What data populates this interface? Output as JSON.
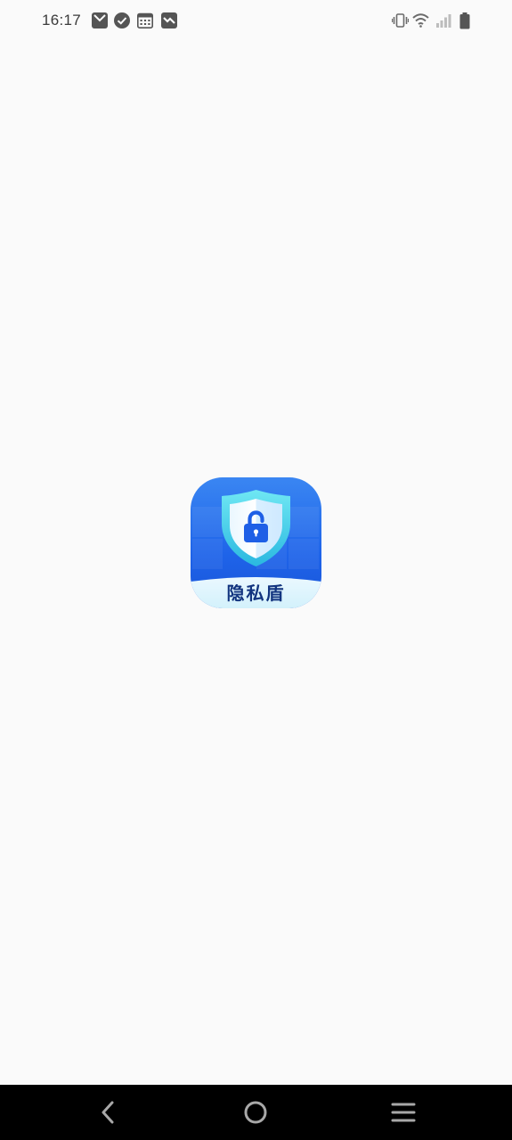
{
  "status_bar": {
    "time": "16:17",
    "notifications": [
      "mail-icon",
      "check-circle-icon",
      "calendar-icon",
      "photo-icon"
    ],
    "system": [
      "vibrate-icon",
      "wifi-icon",
      "signal-icon",
      "battery-icon"
    ]
  },
  "splash": {
    "app_name": "隐私盾",
    "logo": "shield-lock-icon",
    "brand_color": "#1e63e9",
    "accent_color": "#4fd6ea"
  },
  "navigation": {
    "buttons": [
      "back-icon",
      "home-icon",
      "recents-icon"
    ]
  }
}
